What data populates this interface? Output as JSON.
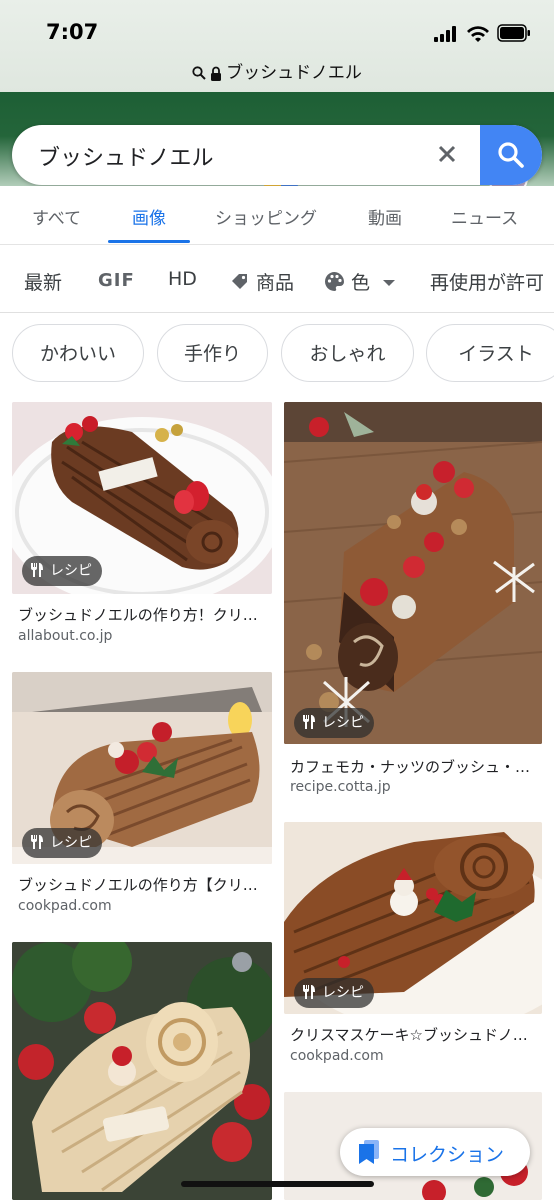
{
  "status_bar": {
    "time": "7:07"
  },
  "url_bar": {
    "text": "ブッシュドノエル"
  },
  "search": {
    "query": "ブッシュドノエル"
  },
  "tabs": [
    {
      "label": "すべて",
      "active": false
    },
    {
      "label": "画像",
      "active": true
    },
    {
      "label": "ショッピング",
      "active": false
    },
    {
      "label": "動画",
      "active": false
    },
    {
      "label": "ニュース",
      "active": false
    }
  ],
  "filters": {
    "latest": "最新",
    "gif": "GIF",
    "hd": "HD",
    "product": "商品",
    "color": "色",
    "reuse": "再使用が許可"
  },
  "chips": [
    "かわいい",
    "手作り",
    "おしゃれ",
    "イラスト"
  ],
  "results": [
    {
      "badge": "レシピ",
      "title": "ブッシュドノエルの作り方！クリ…",
      "source": "allabout.co.jp"
    },
    {
      "badge": "レシピ",
      "title": "カフェモカ・ナッツのブッシュ・…",
      "source": "recipe.cotta.jp"
    },
    {
      "badge": "レシピ",
      "title": "ブッシュドノエルの作り方【クリ…",
      "source": "cookpad.com"
    },
    {
      "badge": "レシピ",
      "title": "クリスマスケーキ☆ブッシュドノ…",
      "source": "cookpad.com"
    }
  ],
  "collection_button": {
    "label": "コレクション"
  },
  "colors": {
    "accent": "#1a73e8",
    "search_button": "#4285f4",
    "header_green": "#1d5f35"
  }
}
